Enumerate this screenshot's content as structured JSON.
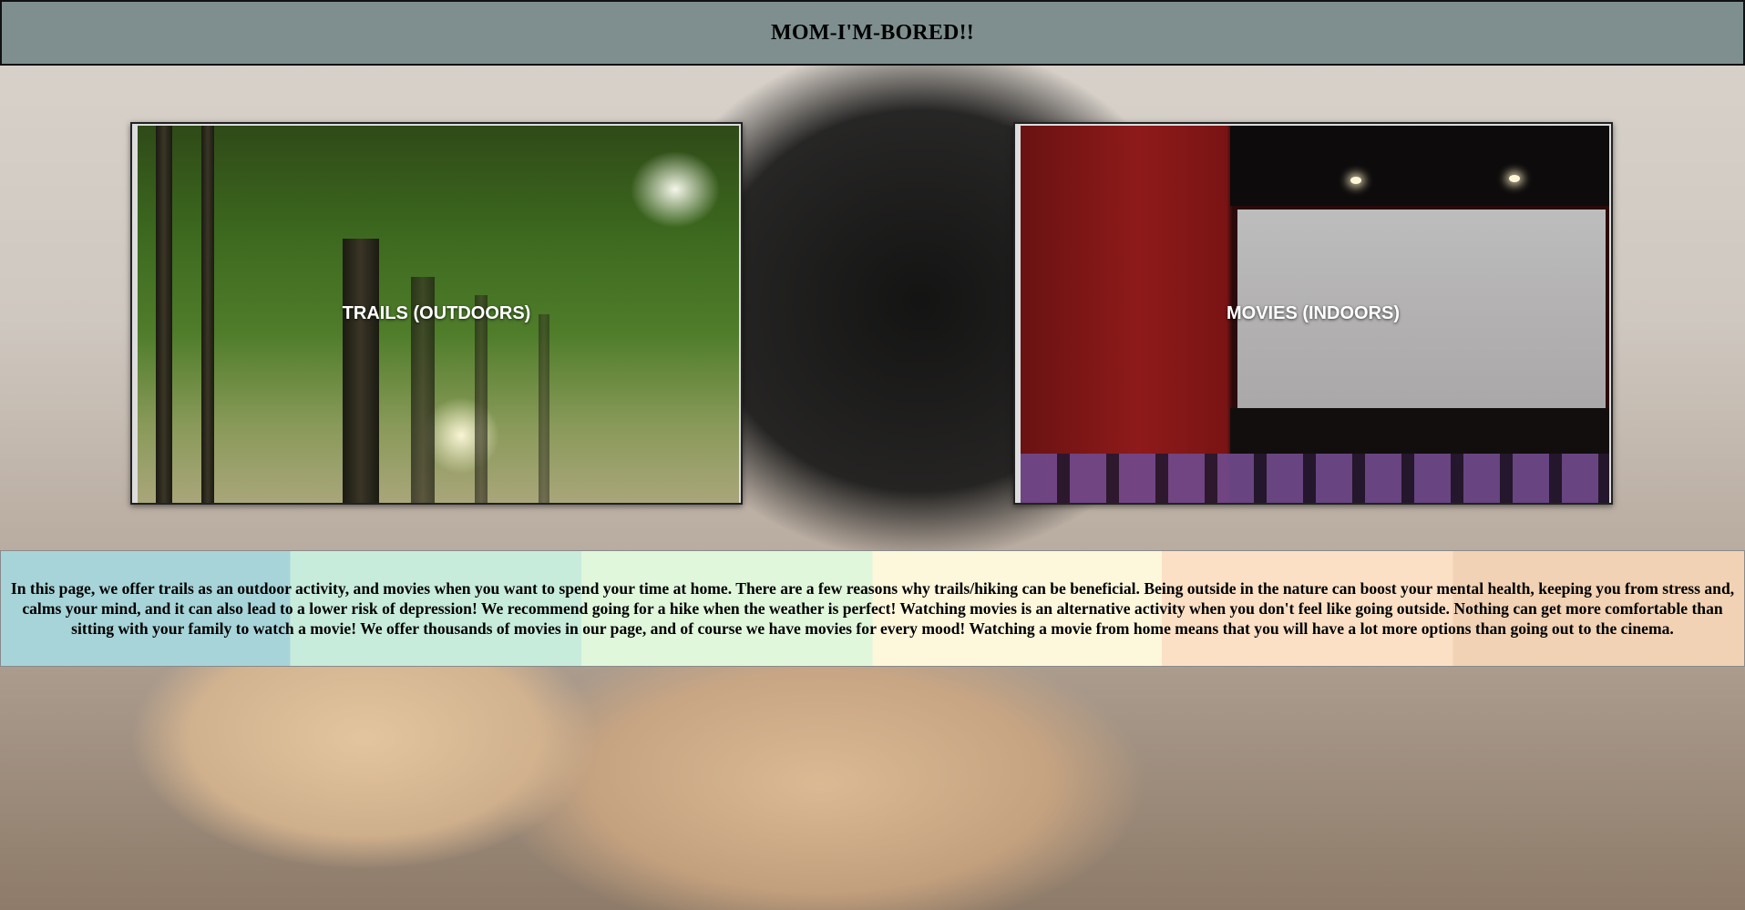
{
  "header": {
    "title": "MOM-I'M-BORED!!"
  },
  "cards": {
    "trails": {
      "label": "TRAILS (OUTDOORS)"
    },
    "movies": {
      "label": "MOVIES (INDOORS)"
    }
  },
  "info": {
    "text": "In this page, we offer trails as an outdoor activity, and movies when you want to spend your time at home. There are a few reasons why trails/hiking can be beneficial. Being outside in the nature can boost your mental health, keeping you from stress and, calms your mind, and it can also lead to a lower risk of depression! We recommend going for a hike when the weather is perfect! Watching movies is an alternative activity when you don't feel like going outside. Nothing can get more comfortable than sitting with your family to watch a movie! We offer thousands of movies in our page, and of course we have movies for every mood! Watching a movie from home means that you will have a lot more options than going out to the cinema."
  },
  "colors": {
    "header_bg": "#7f8f8f",
    "info_bands": [
      "#a7d4d8",
      "#c8ecdc",
      "#e0f7dc",
      "#fdf7dc",
      "#fbe0c6",
      "#f2d2b4"
    ]
  }
}
